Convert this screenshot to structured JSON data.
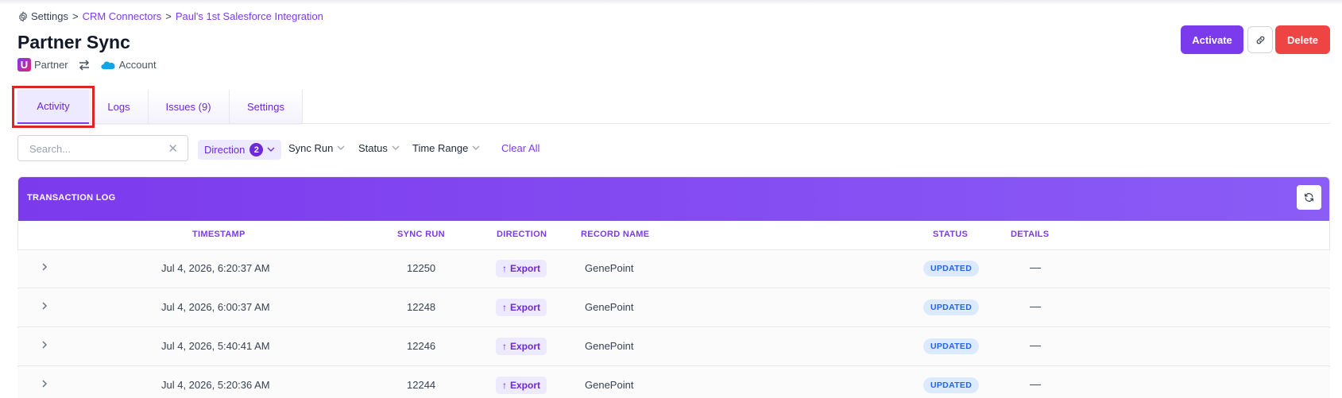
{
  "breadcrumb": {
    "root": "Settings",
    "separator": ">",
    "level1": "CRM Connectors",
    "level2": "Paul's 1st Salesforce Integration"
  },
  "page": {
    "title": "Partner Sync",
    "source_logo_letter": "U",
    "source_label": "Partner",
    "target_label": "Account"
  },
  "actions": {
    "activate_label": "Activate",
    "delete_label": "Delete"
  },
  "tabs": [
    {
      "label": "Activity",
      "active": true
    },
    {
      "label": "Logs",
      "active": false
    },
    {
      "label": "Issues (9)",
      "active": false
    },
    {
      "label": "Settings",
      "active": false
    }
  ],
  "filters": {
    "search_placeholder": "Search...",
    "clear_symbol": "✕",
    "direction_label": "Direction",
    "direction_count": "2",
    "sync_run_label": "Sync Run",
    "status_label": "Status",
    "time_range_label": "Time Range",
    "clear_all_label": "Clear All"
  },
  "transaction_log": {
    "title": "TRANSACTION LOG",
    "columns": {
      "timestamp": "TIMESTAMP",
      "sync_run": "SYNC RUN",
      "direction": "DIRECTION",
      "record_name": "RECORD NAME",
      "status": "STATUS",
      "details": "DETAILS"
    },
    "rows": [
      {
        "timestamp": "Jul 4, 2026, 6:20:37 AM",
        "sync_run": "12250",
        "direction": "Export",
        "record_name": "GenePoint",
        "status": "UPDATED",
        "details": "—"
      },
      {
        "timestamp": "Jul 4, 2026, 6:00:37 AM",
        "sync_run": "12248",
        "direction": "Export",
        "record_name": "GenePoint",
        "status": "UPDATED",
        "details": "—"
      },
      {
        "timestamp": "Jul 4, 2026, 5:40:41 AM",
        "sync_run": "12246",
        "direction": "Export",
        "record_name": "GenePoint",
        "status": "UPDATED",
        "details": "—"
      },
      {
        "timestamp": "Jul 4, 2026, 5:20:36 AM",
        "sync_run": "12244",
        "direction": "Export",
        "record_name": "GenePoint",
        "status": "UPDATED",
        "details": "—"
      }
    ]
  },
  "colors": {
    "accent": "#7c3aed",
    "danger": "#ef4444",
    "status_updated_bg": "#dbeafe",
    "status_updated_text": "#2563eb"
  },
  "icons": [
    "gear-icon",
    "partner-logo-icon",
    "swap-arrows-icon",
    "salesforce-cloud-icon",
    "link-icon",
    "close-icon",
    "chevron-down-icon",
    "refresh-icon",
    "chevron-right-icon",
    "arrow-up-icon"
  ]
}
